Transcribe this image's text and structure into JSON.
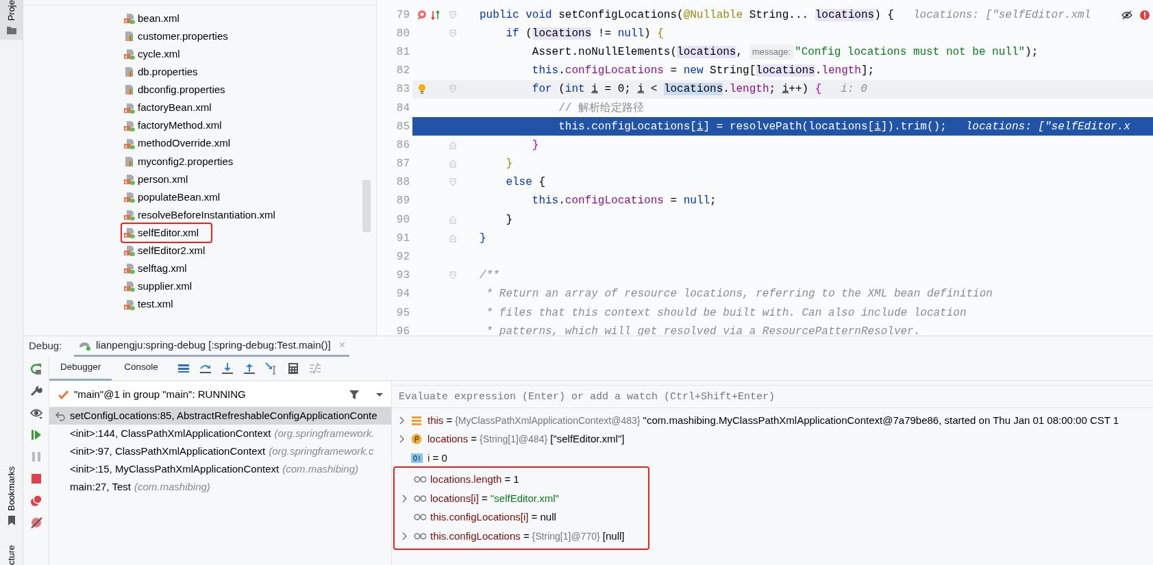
{
  "tool_strip": {
    "top_label": "Proje",
    "bookmarks_label": "Bookmarks",
    "bottom_label": "cture"
  },
  "project_tree": {
    "items": [
      {
        "name": "bean.xml",
        "kind": "xml",
        "highlighted": false
      },
      {
        "name": "customer.properties",
        "kind": "properties",
        "highlighted": false
      },
      {
        "name": "cycle.xml",
        "kind": "xml",
        "highlighted": false
      },
      {
        "name": "db.properties",
        "kind": "properties",
        "highlighted": false
      },
      {
        "name": "dbconfig.properties",
        "kind": "properties",
        "highlighted": false
      },
      {
        "name": "factoryBean.xml",
        "kind": "xml",
        "highlighted": false
      },
      {
        "name": "factoryMethod.xml",
        "kind": "xml",
        "highlighted": false
      },
      {
        "name": "methodOverride.xml",
        "kind": "xml",
        "highlighted": false
      },
      {
        "name": "myconfig2.properties",
        "kind": "properties",
        "highlighted": false
      },
      {
        "name": "person.xml",
        "kind": "xml",
        "highlighted": false
      },
      {
        "name": "populateBean.xml",
        "kind": "xml",
        "highlighted": false
      },
      {
        "name": "resolveBeforeInstantiation.xml",
        "kind": "xml",
        "highlighted": false
      },
      {
        "name": "selfEditor.xml",
        "kind": "xml",
        "highlighted": true
      },
      {
        "name": "selfEditor2.xml",
        "kind": "xml",
        "highlighted": false
      },
      {
        "name": "selftag.xml",
        "kind": "xml",
        "highlighted": false
      },
      {
        "name": "supplier.xml",
        "kind": "xml",
        "highlighted": false
      },
      {
        "name": "test.xml",
        "kind": "xml",
        "highlighted": false
      }
    ]
  },
  "editor": {
    "lines": [
      {
        "number": "79",
        "current": false,
        "selected": false,
        "gutter": [
          {
            "kind": "method"
          },
          {
            "kind": "implemented"
          }
        ],
        "fold": {
          "kind": "open"
        },
        "segments": [
          {
            "kind": "kw",
            "text": "public void"
          },
          {
            "kind": "plain",
            "text": " setConfigLocations("
          },
          {
            "kind": "annot",
            "text": "@Nullable"
          },
          {
            "kind": "plain",
            "text": " String... "
          },
          {
            "kind": "param",
            "text": "locations"
          },
          {
            "kind": "plain",
            "text": ") {"
          }
        ],
        "hint": "locations: [\"selfEditor.xml"
      },
      {
        "number": "80",
        "current": false,
        "selected": false,
        "fold": {
          "kind": "open"
        },
        "segments": [
          {
            "kind": "kw",
            "text": "    if"
          },
          {
            "kind": "plain",
            "text": " ("
          },
          {
            "kind": "param",
            "text": "locations"
          },
          {
            "kind": "plain",
            "text": " != "
          },
          {
            "kind": "kw",
            "text": "null"
          },
          {
            "kind": "plain",
            "text": ") "
          },
          {
            "kind": "brace_olive",
            "text": "{"
          }
        ]
      },
      {
        "number": "81",
        "current": false,
        "selected": false,
        "segments": [
          {
            "kind": "plain",
            "text": "        Assert.noNullElements("
          },
          {
            "kind": "param",
            "text": "locations"
          },
          {
            "kind": "plain",
            "text": ", "
          },
          {
            "kind": "chip",
            "text": "message:"
          },
          {
            "kind": "str",
            "text": "\"Config locations must not be null\""
          },
          {
            "kind": "plain",
            "text": ");"
          }
        ]
      },
      {
        "number": "82",
        "current": false,
        "selected": false,
        "segments": [
          {
            "kind": "kw",
            "text": "        this"
          },
          {
            "kind": "plain",
            "text": "."
          },
          {
            "kind": "field",
            "text": "configLocations"
          },
          {
            "kind": "plain",
            "text": " = "
          },
          {
            "kind": "kw",
            "text": "new"
          },
          {
            "kind": "plain",
            "text": " String["
          },
          {
            "kind": "param",
            "text": "locations"
          },
          {
            "kind": "plain",
            "text": "."
          },
          {
            "kind": "field",
            "text": "length"
          },
          {
            "kind": "plain",
            "text": "];"
          }
        ]
      },
      {
        "number": "83",
        "current": true,
        "selected": false,
        "gutter": [
          {
            "kind": "bulb"
          }
        ],
        "fold": {
          "kind": "open"
        },
        "segments": [
          {
            "kind": "kw",
            "text": "        for"
          },
          {
            "kind": "plain",
            "text": " ("
          },
          {
            "kind": "kw",
            "text": "int "
          },
          {
            "kind": "var",
            "text": "i"
          },
          {
            "kind": "plain",
            "text": " = 0; "
          },
          {
            "kind": "var",
            "text": "i"
          },
          {
            "kind": "plain",
            "text": " < "
          },
          {
            "kind": "param_caret",
            "text": "locations"
          },
          {
            "kind": "plain",
            "text": "."
          },
          {
            "kind": "field",
            "text": "length"
          },
          {
            "kind": "plain",
            "text": "; "
          },
          {
            "kind": "var",
            "text": "i"
          },
          {
            "kind": "plain",
            "text": "++) "
          },
          {
            "kind": "brace_magenta",
            "text": "{"
          }
        ],
        "hint": "i: 0"
      },
      {
        "number": "84",
        "current": false,
        "selected": false,
        "segments": [
          {
            "kind": "cmt",
            "text": "            // 解析给定路径"
          }
        ]
      },
      {
        "number": "85",
        "current": false,
        "selected": true,
        "segments": [
          {
            "kind": "kw",
            "text": "            this"
          },
          {
            "kind": "plain",
            "text": "."
          },
          {
            "kind": "field",
            "text": "configLocations"
          },
          {
            "kind": "plain",
            "text": "["
          },
          {
            "kind": "var",
            "text": "i"
          },
          {
            "kind": "plain",
            "text": "] = resolvePath(locations["
          },
          {
            "kind": "var",
            "text": "i"
          },
          {
            "kind": "plain",
            "text": "]).trim();"
          }
        ],
        "hint": "locations: [\"selfEditor.x"
      },
      {
        "number": "86",
        "current": false,
        "selected": false,
        "fold": {
          "kind": "close"
        },
        "segments": [
          {
            "kind": "brace_magenta",
            "text": "        }"
          }
        ]
      },
      {
        "number": "87",
        "current": false,
        "selected": false,
        "fold": {
          "kind": "close"
        },
        "segments": [
          {
            "kind": "brace_olive",
            "text": "    }"
          }
        ]
      },
      {
        "number": "88",
        "current": false,
        "selected": false,
        "fold": {
          "kind": "open"
        },
        "segments": [
          {
            "kind": "kw",
            "text": "    else"
          },
          {
            "kind": "plain",
            "text": " {"
          }
        ]
      },
      {
        "number": "89",
        "current": false,
        "selected": false,
        "segments": [
          {
            "kind": "kw",
            "text": "        this"
          },
          {
            "kind": "plain",
            "text": "."
          },
          {
            "kind": "field",
            "text": "configLocations"
          },
          {
            "kind": "plain",
            "text": " = "
          },
          {
            "kind": "kw",
            "text": "null"
          },
          {
            "kind": "plain",
            "text": ";"
          }
        ]
      },
      {
        "number": "90",
        "current": false,
        "selected": false,
        "fold": {
          "kind": "close"
        },
        "segments": [
          {
            "kind": "plain",
            "text": "    }"
          }
        ]
      },
      {
        "number": "91",
        "current": false,
        "selected": false,
        "fold": {
          "kind": "close"
        },
        "segments": [
          {
            "kind": "brace_blue",
            "text": "}"
          }
        ]
      },
      {
        "number": "92",
        "current": false,
        "selected": false
      },
      {
        "number": "93",
        "current": false,
        "selected": false,
        "fold": {
          "kind": "open"
        },
        "segments": [
          {
            "kind": "doc",
            "text": "/**"
          }
        ]
      },
      {
        "number": "94",
        "current": false,
        "selected": false,
        "segments": [
          {
            "kind": "doc",
            "text": " * Return an array of resource locations, referring to the XML bean definition"
          }
        ]
      },
      {
        "number": "95",
        "current": false,
        "selected": false,
        "segments": [
          {
            "kind": "doc",
            "text": " * files that this context should be built with. Can also include location"
          }
        ]
      },
      {
        "number": "96",
        "current": false,
        "selected": false,
        "segments": [
          {
            "kind": "doc",
            "text": " * patterns, which will get resolved via a ResourcePatternResolver."
          }
        ]
      }
    ]
  },
  "debug": {
    "label": "Debug:",
    "session": "lianpengju:spring-debug [:spring-debug:Test.main()]",
    "close": "×",
    "tabs": [
      {
        "label": "Debugger",
        "selected": true
      },
      {
        "label": "Console",
        "selected": false
      }
    ],
    "thread": "\"main\"@1 in group \"main\": RUNNING",
    "frames": [
      {
        "location": "setConfigLocations:85, AbstractRefreshableConfigApplicationConte",
        "selected": true
      },
      {
        "location": "<init>:144, ClassPathXmlApplicationContext",
        "package": "(org.springframework.",
        "selected": false
      },
      {
        "location": "<init>:97, ClassPathXmlApplicationContext",
        "package": "(org.springframework.c",
        "selected": false
      },
      {
        "location": "<init>:15, MyClassPathXmlApplicationContext",
        "package": "(com.mashibing)",
        "selected": false
      },
      {
        "location": "main:27, Test",
        "package": "(com.mashibing)",
        "selected": false
      }
    ],
    "evaluate": {
      "placeholder": "Evaluate expression (Enter) or add a watch (Ctrl+Shift+Enter)"
    },
    "variables": [
      {
        "kind": "object",
        "expandable": true,
        "name": "this",
        "parts": [
          {
            "kind": "plain",
            "text": "="
          },
          {
            "kind": "ref",
            "text": "{MyClassPathXmlApplicationContext@483}"
          },
          {
            "kind": "plain",
            "text": "\"com.mashibing.MyClassPathXmlApplicationContext@7a79be86, started on Thu Jan 01 08:00:00 CST 1"
          }
        ]
      },
      {
        "kind": "param",
        "expandable": true,
        "name": "locations",
        "parts": [
          {
            "kind": "plain",
            "text": "="
          },
          {
            "kind": "ref",
            "text": "{String[1]@484}"
          },
          {
            "kind": "plain",
            "text": "[\"selfEditor.xml\"]"
          }
        ]
      },
      {
        "kind": "int",
        "expandable": false,
        "name": "i",
        "parts": [
          {
            "kind": "plain",
            "text": "="
          },
          {
            "kind": "plain",
            "text": "0"
          }
        ]
      }
    ],
    "watches": {
      "highlighted": true,
      "items": [
        {
          "kind": "watch",
          "expandable": false,
          "name": "locations.length",
          "parts": [
            {
              "kind": "plain",
              "text": "="
            },
            {
              "kind": "plain",
              "text": "1"
            }
          ]
        },
        {
          "kind": "watch",
          "expandable": true,
          "name": "locations[i]",
          "parts": [
            {
              "kind": "plain",
              "text": "="
            },
            {
              "kind": "str",
              "text": "\"selfEditor.xml\""
            }
          ]
        },
        {
          "kind": "watch",
          "expandable": false,
          "name": "this.configLocations[i]",
          "parts": [
            {
              "kind": "plain",
              "text": "="
            },
            {
              "kind": "plain",
              "text": "null"
            }
          ]
        },
        {
          "kind": "watch",
          "expandable": true,
          "name": "this.configLocations",
          "parts": [
            {
              "kind": "plain",
              "text": "="
            },
            {
              "kind": "ref",
              "text": "{String[1]@770}"
            },
            {
              "kind": "plain",
              "text": "[null]"
            }
          ]
        }
      ]
    }
  }
}
